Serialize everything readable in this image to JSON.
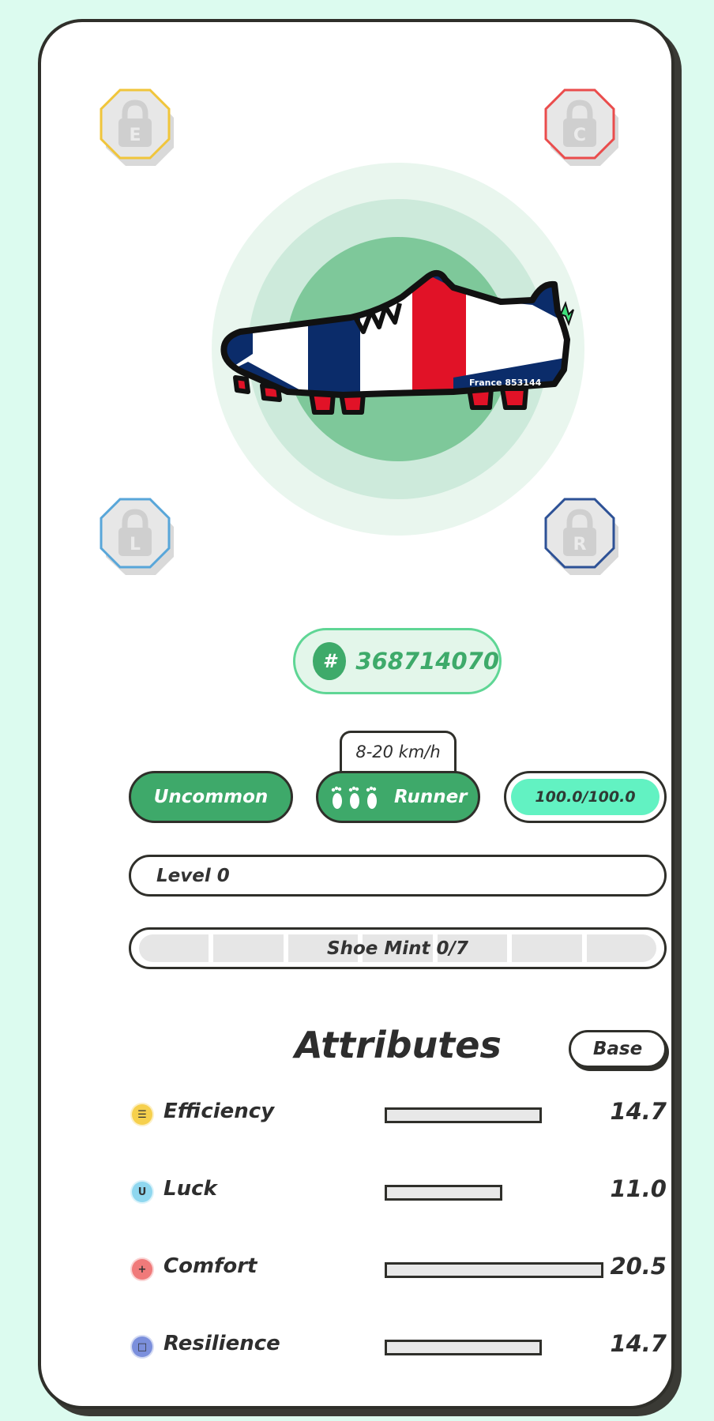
{
  "gem_slots": [
    {
      "letter": "E",
      "color": "#f0c53b"
    },
    {
      "letter": "C",
      "color": "#ea4c4c"
    },
    {
      "letter": "L",
      "color": "#58a6d9"
    },
    {
      "letter": "R",
      "color": "#2d5196"
    }
  ],
  "shoe": {
    "name": "France",
    "serial": "853144",
    "colors": {
      "blue": "#0b2c6a",
      "red": "#e11227",
      "white": "#ffffff",
      "lightning": "#3ee07a"
    }
  },
  "token_id": {
    "hash_symbol": "#",
    "number": "368714070"
  },
  "speed_range": "8-20 km/h",
  "rarity": "Uncommon",
  "shoe_type": "Runner",
  "durability": {
    "label": "100.0/100.0",
    "value": 100.0,
    "max": 100.0
  },
  "level": {
    "label": "Level 0"
  },
  "shoe_mint": {
    "label": "Shoe Mint 0/7",
    "segments": 7,
    "used": 0
  },
  "attributes": {
    "title": "Attributes",
    "toggle_label": "Base",
    "max_value": 21,
    "items": [
      {
        "name": "Efficiency",
        "value": "14.7",
        "icon": "efficiency-icon",
        "icon_glyph": "☰",
        "color": "#f6d04d"
      },
      {
        "name": "Luck",
        "value": "11.0",
        "icon": "luck-icon",
        "icon_glyph": "U",
        "color": "#8fd7ef"
      },
      {
        "name": "Comfort",
        "value": "20.5",
        "icon": "comfort-icon",
        "icon_glyph": "+",
        "color": "#f07a7a"
      },
      {
        "name": "Resilience",
        "value": "14.7",
        "icon": "resilience-icon",
        "icon_glyph": "□",
        "color": "#7b8fdc"
      }
    ]
  }
}
